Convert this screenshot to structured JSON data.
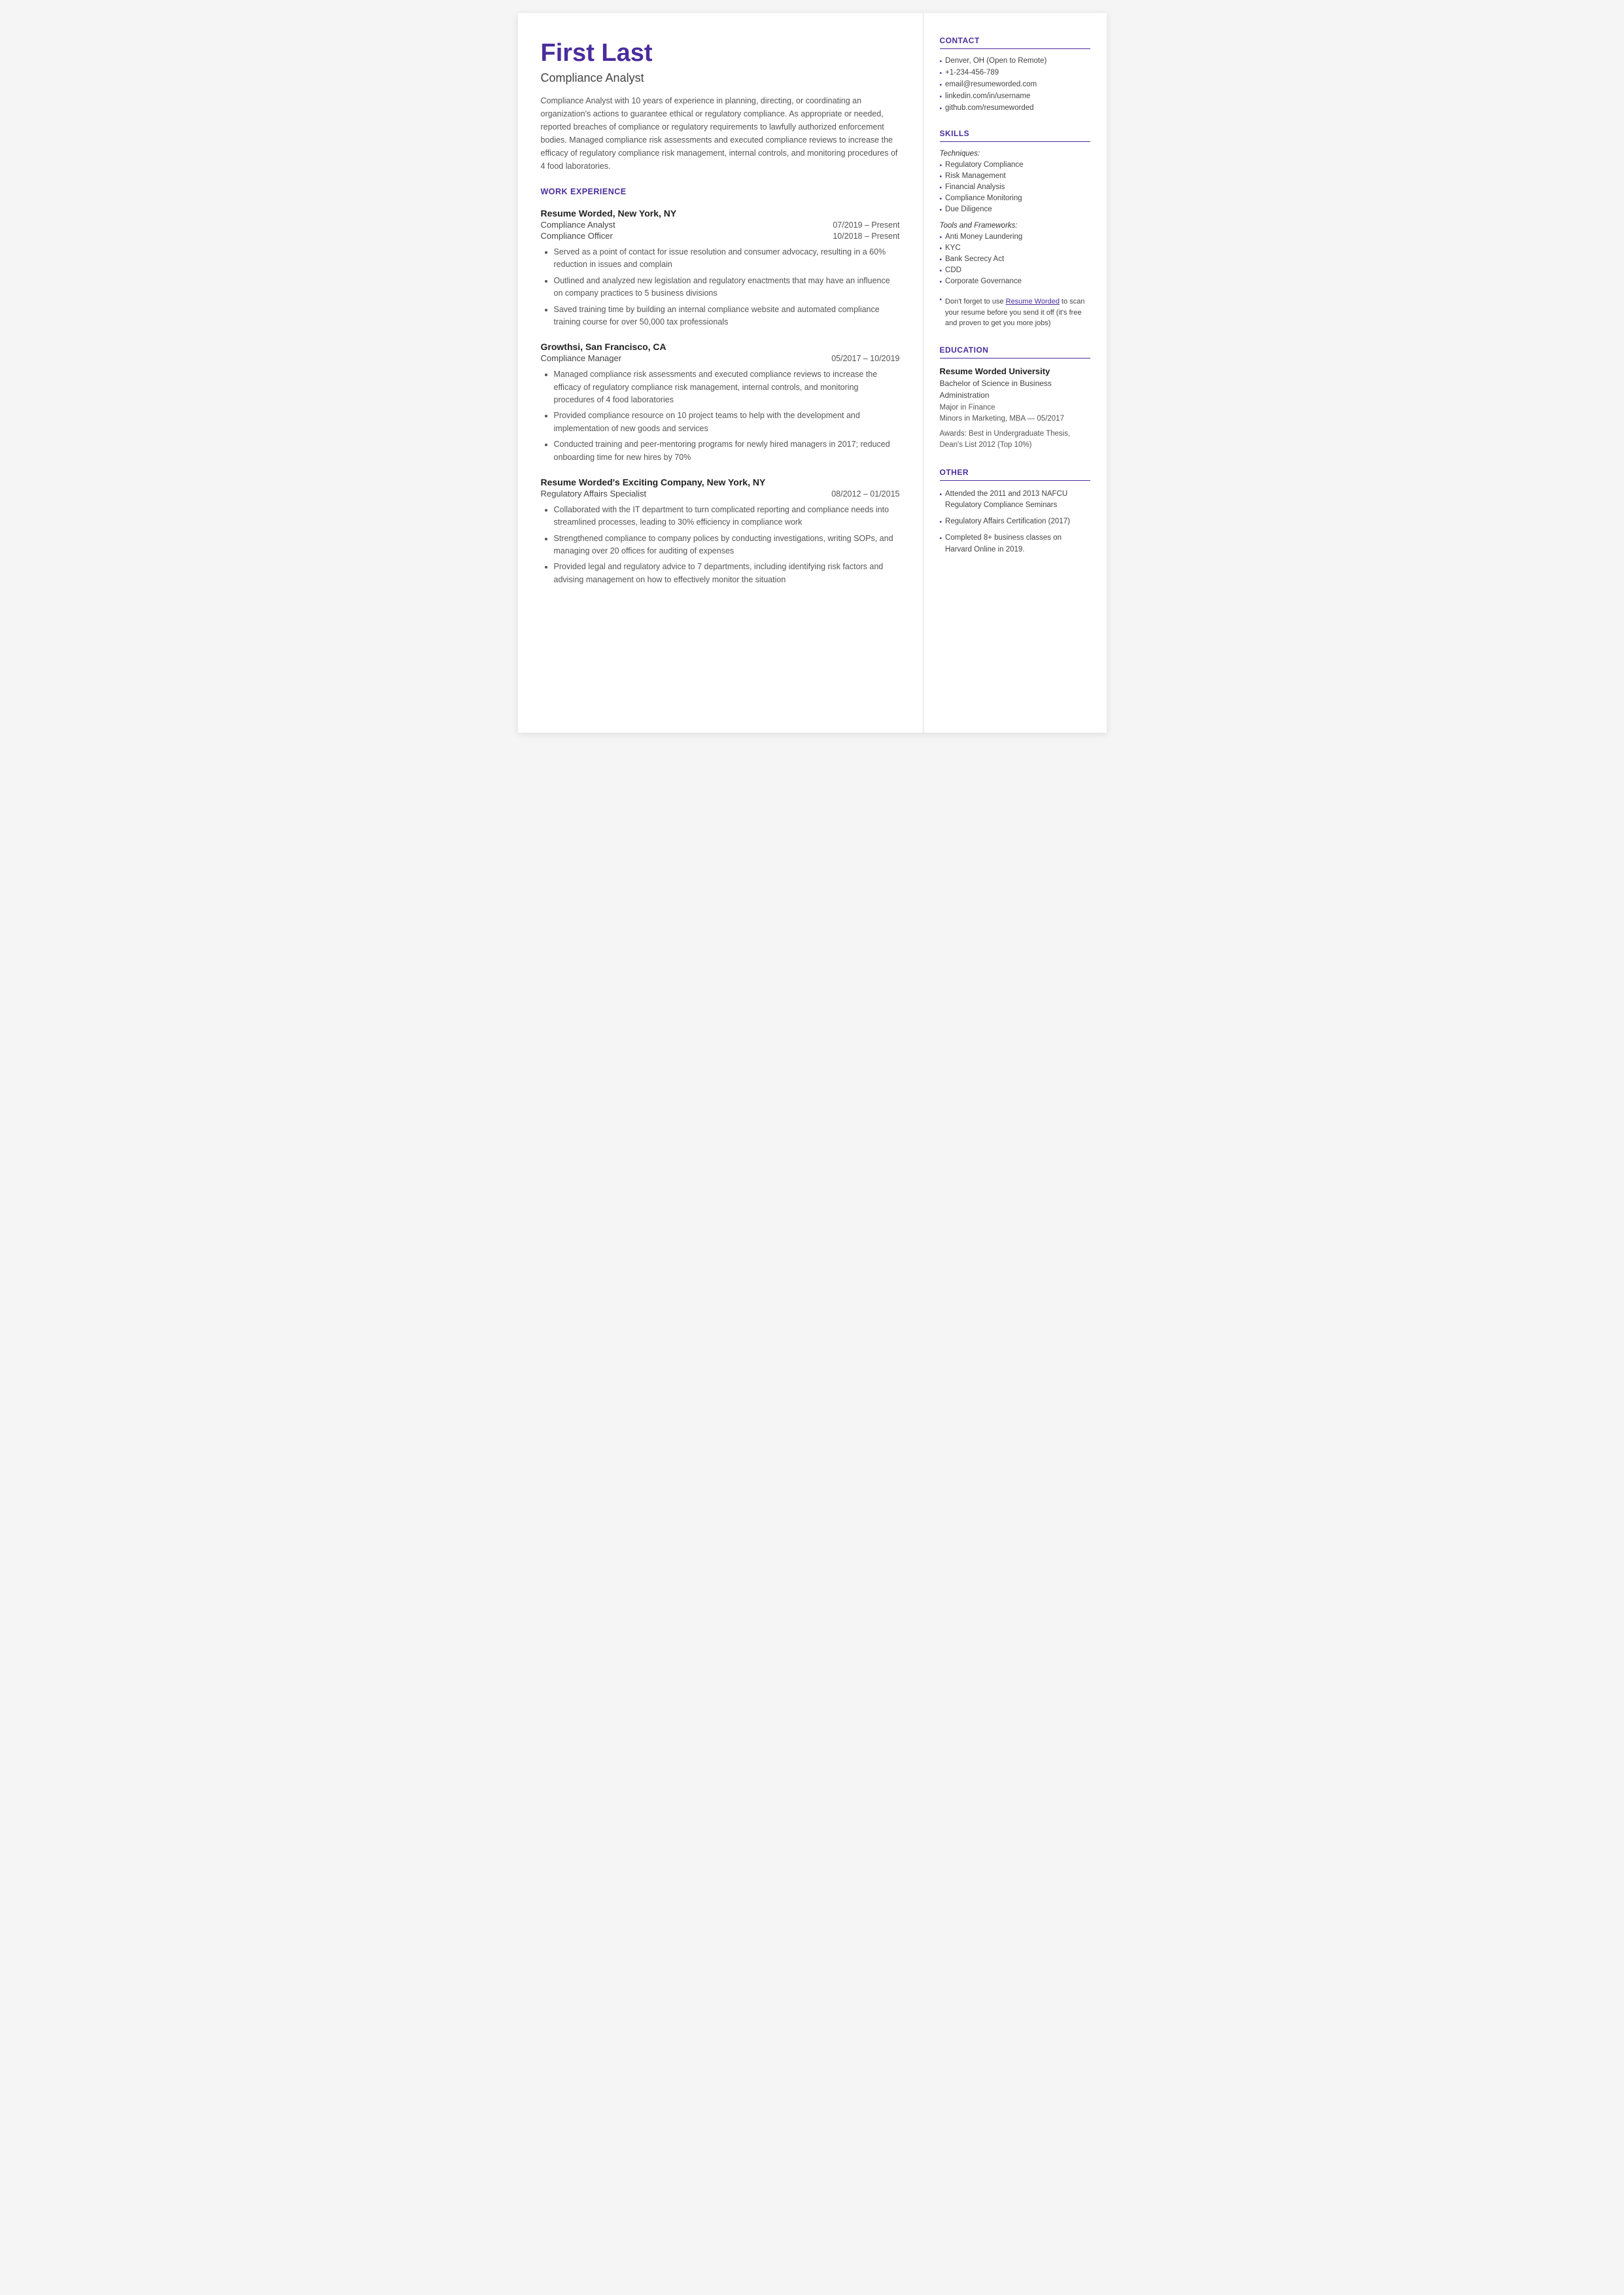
{
  "header": {
    "name": "First Last",
    "title": "Compliance Analyst",
    "summary": "Compliance Analyst with 10 years of experience in planning, directing, or coordinating an organization's actions to guarantee ethical or regulatory compliance. As appropriate or needed, reported breaches of compliance or regulatory requirements to lawfully authorized enforcement bodies. Managed compliance risk assessments and executed compliance reviews to increase the efficacy of regulatory compliance risk management, internal controls, and monitoring procedures of 4 food laboratories."
  },
  "work_experience": {
    "section_title": "WORK EXPERIENCE",
    "jobs": [
      {
        "company": "Resume Worded, New York, NY",
        "roles": [
          {
            "title": "Compliance Analyst",
            "dates": "07/2019 – Present"
          },
          {
            "title": "Compliance Officer",
            "dates": "10/2018 – Present"
          }
        ],
        "bullets": [
          "Served as a point of contact for issue resolution and consumer advocacy, resulting in a 60% reduction in issues and complain",
          "Outlined and analyzed new legislation and regulatory enactments that may have an influence on company practices to 5 business divisions",
          "Saved training time by building an internal compliance website and automated compliance training course for over 50,000 tax professionals"
        ]
      },
      {
        "company": "Growthsi, San Francisco, CA",
        "roles": [
          {
            "title": "Compliance Manager",
            "dates": "05/2017 – 10/2019"
          }
        ],
        "bullets": [
          "Managed compliance risk assessments and executed compliance reviews to increase the efficacy of regulatory compliance risk management, internal controls, and monitoring procedures of 4 food laboratories",
          "Provided compliance resource on 10 project teams to help with the development and implementation of new goods and services",
          "Conducted training and peer-mentoring programs for newly hired managers in 2017; reduced onboarding time for new hires by 70%"
        ]
      },
      {
        "company": "Resume Worded's Exciting Company, New York, NY",
        "roles": [
          {
            "title": "Regulatory Affairs Specialist",
            "dates": "08/2012 – 01/2015"
          }
        ],
        "bullets": [
          "Collaborated with the IT department to turn complicated reporting and compliance needs into streamlined processes, leading to 30% efficiency in compliance work",
          "Strengthened compliance to company polices by conducting investigations, writing SOPs, and managing over 20 offices for auditing of expenses",
          "Provided legal and regulatory advice to 7 departments, including identifying risk factors and advising management on how to effectively monitor the situation"
        ]
      }
    ]
  },
  "contact": {
    "section_title": "CONTACT",
    "items": [
      "Denver, OH (Open to Remote)",
      "+1-234-456-789",
      "email@resumeworded.com",
      "linkedin.com/in/username",
      "github.com/resumeworded"
    ]
  },
  "skills": {
    "section_title": "SKILLS",
    "techniques_label": "Techniques:",
    "techniques": [
      "Regulatory Compliance",
      "Risk Management",
      "Financial Analysis",
      "Compliance Monitoring",
      "Due Diligence"
    ],
    "tools_label": "Tools and Frameworks:",
    "tools": [
      "Anti Money Laundering",
      "KYC",
      "Bank Secrecy Act",
      "CDD",
      "Corporate Governance"
    ],
    "note_prefix": "Don't forget to use ",
    "note_link_text": "Resume Worded",
    "note_suffix": " to scan your resume before you send it off (it's free and proven to get you more jobs)"
  },
  "education": {
    "section_title": "EDUCATION",
    "school": "Resume Worded University",
    "degree": "Bachelor of Science in Business Administration",
    "major": "Major in Finance",
    "minor": "Minors in Marketing, MBA — 05/2017",
    "awards": "Awards: Best in Undergraduate Thesis, Dean's List 2012 (Top 10%)"
  },
  "other": {
    "section_title": "OTHER",
    "items": [
      "Attended the 2011 and 2013 NAFCU Regulatory Compliance Seminars",
      "Regulatory Affairs Certification (2017)",
      "Completed 8+ business classes on Harvard Online in 2019."
    ]
  }
}
